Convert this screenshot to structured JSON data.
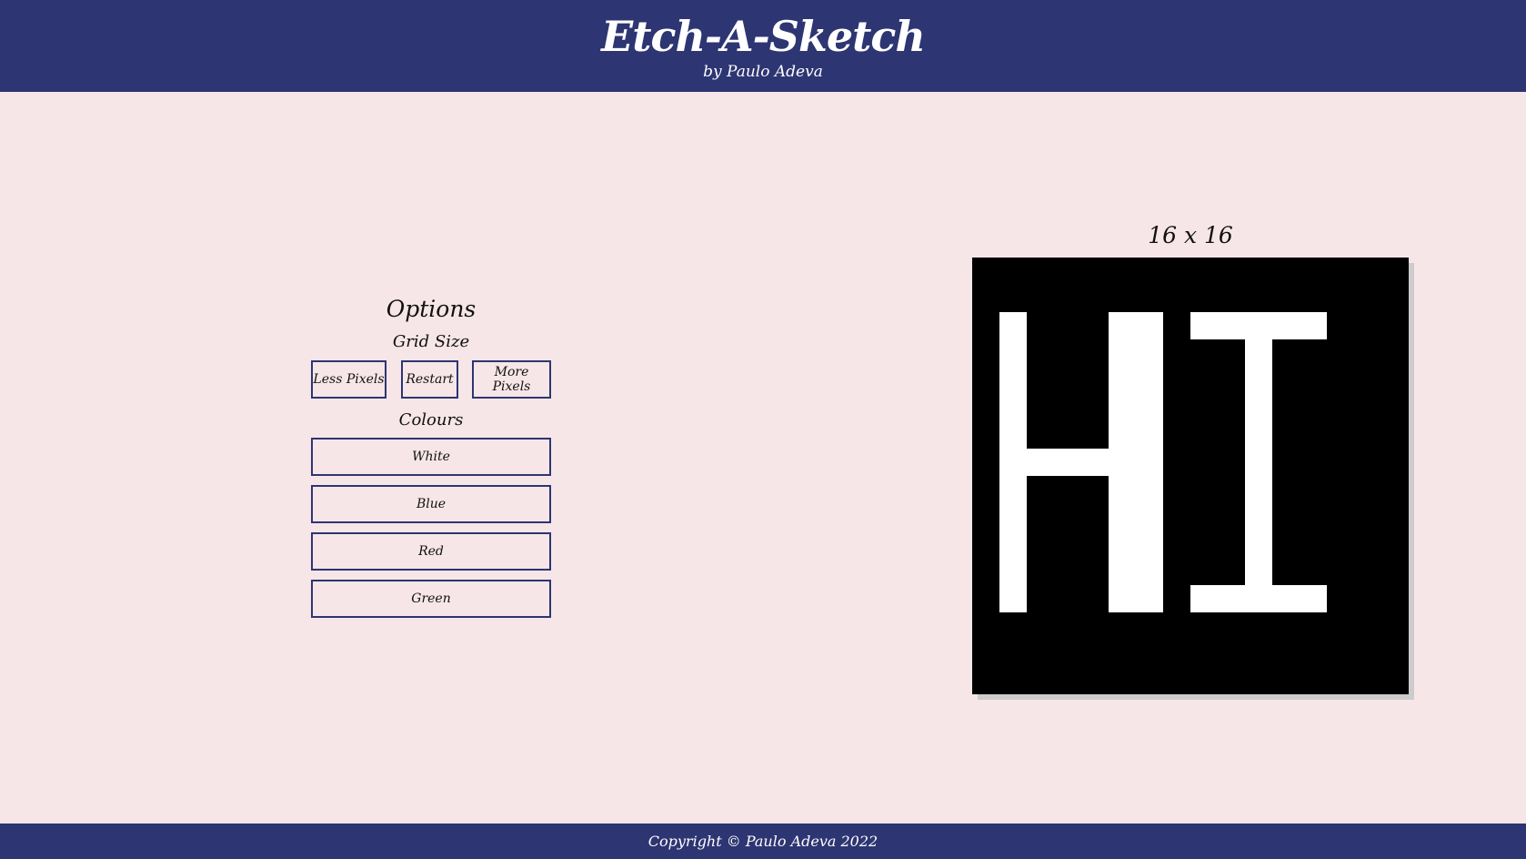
{
  "header": {
    "title": "Etch-A-Sketch",
    "subtitle": "by Paulo Adeva"
  },
  "options": {
    "heading": "Options",
    "grid_size_label": "Grid Size",
    "buttons": {
      "less_pixels": "Less Pixels",
      "restart": "Restart",
      "more_pixels": "More Pixels"
    },
    "colours_label": "Colours",
    "colours": [
      "White",
      "Blue",
      "Red",
      "Green"
    ]
  },
  "grid": {
    "size_label": "16 x 16",
    "size": 16,
    "background_color": "#000000",
    "ink_color": "#ffffff",
    "rows": [
      "0000000000000000",
      "0000000000000000",
      "0100011011111000",
      "0100011000100000",
      "0100011000100000",
      "0100011000100000",
      "0100011000100000",
      "0111111000100000",
      "0100011000100000",
      "0100011000100000",
      "0100011000100000",
      "0100011000100000",
      "0100011011111000",
      "0000000000000000",
      "0000000000000000",
      "0000000000000000"
    ]
  },
  "footer": {
    "copyright": "Copyright © Paulo Adeva 2022"
  },
  "colors": {
    "navy": "#2d3572",
    "background": "#f7e6e8"
  }
}
